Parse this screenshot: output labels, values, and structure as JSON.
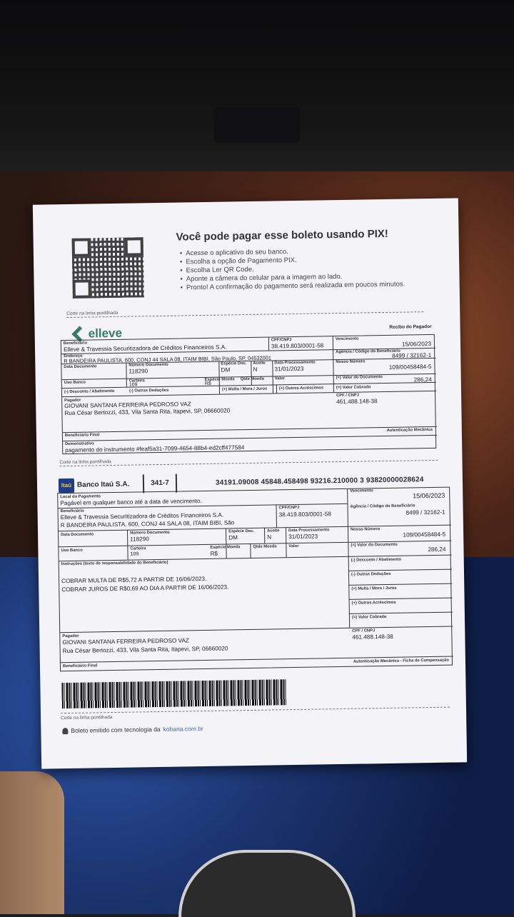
{
  "pix": {
    "title": "Você pode pagar esse boleto usando PIX!",
    "steps": [
      "Acesse o aplicativo do seu banco.",
      "Escolha a opção de Pagamento PIX.",
      "Escolha Ler QR Code.",
      "Aponte a câmera do celular para a imagem ao lado.",
      "Pronto! A confirmação do pagamento será realizada em poucos minutos."
    ]
  },
  "cut_text": "Corte na linha pontilhada",
  "brand": {
    "name": "elleve"
  },
  "recibo": {
    "title": "Recibo do Pagador",
    "labels": {
      "beneficiario": "Beneficiário",
      "cpf_cnpj": "CPF/CNPJ",
      "vencimento": "Vencimento",
      "endereco": "Endereço",
      "agencia": "Agência / Código do Beneficiário",
      "data_documento": "Data Documento",
      "numero_documento": "Número Documento",
      "especie_doc": "Espécie Doc.",
      "aceite": "Aceite",
      "data_processamento": "Data Processamento",
      "nosso_numero": "Nosso Número",
      "uso_banco": "Uso Banco",
      "carteira": "Carteira",
      "especie_moeda": "Espécie Moeda",
      "qtde_moeda": "Qtde Moeda",
      "valor": "Valor",
      "valor_documento": "(=) Valor do Documento",
      "desconto": "(-) Desconto / Abatimento",
      "outras_deducoes": "(-) Outras Deduções",
      "multa": "(+) Multa / Mora / Juros",
      "outros_acrescimos": "(+) Outros Acréscimos",
      "valor_cobrado": "(=) Valor Cobrado",
      "pagador": "Pagador",
      "cpf_cnpj2": "CPF / CNPJ",
      "beneficiario_final": "Beneficiário Final",
      "autenticacao": "Autenticação Mecânica",
      "demonstrativo": "Demonstrativo"
    },
    "beneficiario": "Elleve & Travessia Securitizadora de Créditos Financeiros S.A.",
    "cnpj": "38.419.803/0001-58",
    "vencimento": "15/06/2023",
    "endereco": "R BANDEIRA PAULISTA, 600, CONJ 44 SALA 08, ITAIM BIBI, São Paulo, SP, 04532001",
    "agencia": "8499 / 32162-1",
    "numero_documento": "118290",
    "especie_doc": "DM",
    "aceite": "N",
    "data_processamento": "31/01/2023",
    "nosso_numero": "109/00458484-5",
    "carteira": "109",
    "especie_moeda": "R$",
    "valor_documento": "286,24",
    "pagador_nome": "GIOVANI SANTANA FERREIRA PEDROSO VAZ",
    "pagador_endereco": "Rua César Bertozzi, 433, Vila Santa Rita, Itapevi, SP, 06660020",
    "pagador_cpf": "461.488.148-38",
    "demonstrativo": "pagamento do instrumento #feaf5a31-7099-4654-88b4-ed2cff477584"
  },
  "ficha": {
    "bank_logo": "Itaú",
    "bank_name": "Banco Itaú S.A.",
    "bank_code": "341-7",
    "linha_digitavel": "34191.09008 45848.458498 93216.210000 3 93820000028624",
    "labels": {
      "local_pagamento": "Local do Pagamento",
      "vencimento": "Vencimento",
      "beneficiario": "Beneficiário",
      "cpf_cnpj": "CPF/CNPJ",
      "agencia": "Agência / Código do Beneficiário",
      "data_documento": "Data Documento",
      "numero_documento": "Número Documento",
      "especie_doc": "Espécie Doc.",
      "aceite": "Aceite",
      "data_processamento": "Data Processamento",
      "nosso_numero": "Nosso Número",
      "uso_banco": "Uso Banco",
      "carteira": "Carteira",
      "especie_moeda": "Espécie Moeda",
      "qtde_moeda": "Qtde Moeda",
      "valor": "Valor",
      "valor_documento": "(=) Valor do Documento",
      "instrucoes": "Instruções (texto de responsabilidade do Beneficiário)",
      "desconto": "(-) Desconto / Abatimento",
      "outras_deducoes": "(-) Outras Deduções",
      "multa": "(+) Multa / Mora / Juros",
      "outros_acrescimos": "(+) Outros Acréscimos",
      "valor_cobrado": "(=) Valor Cobrado",
      "pagador": "Pagador",
      "cpf_cnpj2": "CPF / CNPJ",
      "beneficiario_final": "Beneficiário Final",
      "autenticacao": "Autenticação Mecânica - Ficha de Compensação"
    },
    "local_pagamento": "Pagável em qualquer banco até a data de vencimento.",
    "vencimento": "15/06/2023",
    "beneficiario": "Elleve & Travessia Securitizadora de Créditos Financeiros S.A.",
    "endereco": "R BANDEIRA PAULISTA, 600, CONJ 44 SALA 08, ITAIM BIBI, São",
    "cnpj": "38.419.803/0001-58",
    "agencia": "8499 / 32162-1",
    "numero_documento": "118290",
    "especie_doc": "DM",
    "aceite": "N",
    "data_processamento": "31/01/2023",
    "nosso_numero": "109/00458484-5",
    "carteira": "109",
    "especie_moeda": "R$",
    "valor_documento": "286,24",
    "instrucao_1": "COBRAR MULTA DE R$5,72 A PARTIR DE 16/06/2023.",
    "instrucao_2": "COBRAR JUROS DE R$0,69 AO DIA A PARTIR DE 16/06/2023.",
    "pagador_nome": "GIOVANI SANTANA FERREIRA PEDROSO VAZ",
    "pagador_endereco": "Rua César Bertozzi, 433, Vila Santa Rita, Itapevi, SP, 06660020",
    "pagador_cpf": "461.488.148-38"
  },
  "footer": {
    "kobana_text": "Boleto emitido com tecnologia da",
    "kobana_link": "kobana.com.br"
  }
}
